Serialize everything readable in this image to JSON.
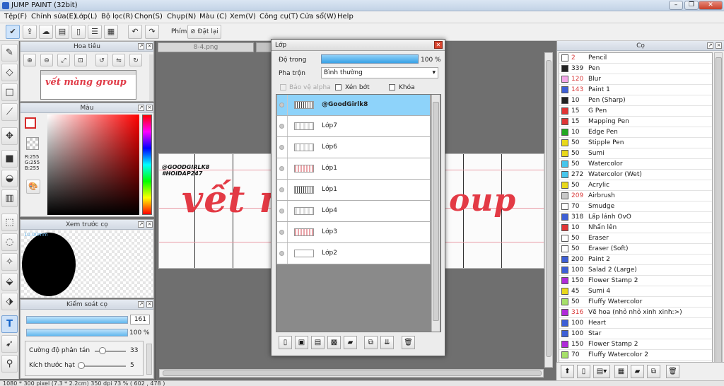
{
  "window": {
    "title": "JUMP PAINT (32bit)"
  },
  "menu": [
    "Tệp(F)",
    "Chỉnh sửa(E)",
    "Lớp(L)",
    "Bộ lọc(R)",
    "Chọn(S)",
    "Chụp(N)",
    "Màu (C)",
    "Xem(V)",
    "Công cụ(T)",
    "Cửa sổ(W)",
    "Help"
  ],
  "toolbar": {
    "phim_label": "Phím",
    "reset_label": "Đặt lại"
  },
  "navigator": {
    "title": "Hoa tiêu",
    "thumb_text": "vết màng group"
  },
  "color": {
    "title": "Màu",
    "r": "R:255",
    "g": "G:255",
    "b": "B:255"
  },
  "preview": {
    "title": "Xem trước cọ",
    "size": "10.00mm"
  },
  "brush_control": {
    "title": "Kiểm soát cọ",
    "size_value": "161",
    "opacity_value": "100 %",
    "scatter_label": "Cường độ phân tán",
    "scatter_value": "33",
    "grain_label": "Kích thước hạt",
    "grain_value": "5"
  },
  "document": {
    "tab": "8-4.png",
    "tags": "@GOODGIRLK8\n#HOIDAP247",
    "banner_left": "vết m",
    "banner_right": "oup"
  },
  "layers": {
    "title": "Lớp",
    "opacity_label": "Độ trong",
    "opacity_value": "100 %",
    "blend_label": "Pha trộn",
    "blend_value": "Bình thường",
    "protect_alpha": "Bảo vệ alpha",
    "clip": "Xén bớt",
    "lock": "Khóa",
    "items": [
      "@GoodGirlk8",
      "Lớp7",
      "Lớp6",
      "Lớp1",
      "Lớp1",
      "Lớp4",
      "Lớp3",
      "Lớp2"
    ]
  },
  "brushes": {
    "title": "Cọ",
    "items": [
      {
        "size": "2",
        "name": "Pencil",
        "color": "#ffffff",
        "red": true
      },
      {
        "size": "339",
        "name": "Pen",
        "color": "#222222",
        "red": false
      },
      {
        "size": "120",
        "name": "Blur",
        "color": "#f3a6e8",
        "red": true
      },
      {
        "size": "143",
        "name": "Paint 1",
        "color": "#3d5fd6",
        "red": true
      },
      {
        "size": "10",
        "name": "Pen (Sharp)",
        "color": "#222222",
        "red": false
      },
      {
        "size": "15",
        "name": "G Pen",
        "color": "#e03535",
        "red": false
      },
      {
        "size": "15",
        "name": "Mapping Pen",
        "color": "#e03535",
        "red": false
      },
      {
        "size": "10",
        "name": "Edge Pen",
        "color": "#22a822",
        "red": false
      },
      {
        "size": "50",
        "name": "Stipple Pen",
        "color": "#e8d81a",
        "red": false
      },
      {
        "size": "50",
        "name": "Sumi",
        "color": "#e8d81a",
        "red": false
      },
      {
        "size": "50",
        "name": "Watercolor",
        "color": "#47c6ec",
        "red": false
      },
      {
        "size": "272",
        "name": "Watercolor (Wet)",
        "color": "#47c6ec",
        "red": false
      },
      {
        "size": "50",
        "name": "Acrylic",
        "color": "#e8d81a",
        "red": false
      },
      {
        "size": "209",
        "name": "Airbrush",
        "color": "#c8c8c8",
        "red": true
      },
      {
        "size": "70",
        "name": "Smudge",
        "color": "#ffffff",
        "red": false
      },
      {
        "size": "318",
        "name": "Lấp lánh OvO",
        "color": "#3d5fd6",
        "red": false
      },
      {
        "size": "10",
        "name": "Nhấn lên",
        "color": "#e03535",
        "red": false
      },
      {
        "size": "50",
        "name": "Eraser",
        "color": "#ffffff",
        "red": false
      },
      {
        "size": "50",
        "name": "Eraser (Soft)",
        "color": "#ffffff",
        "red": false
      },
      {
        "size": "200",
        "name": "Paint 2",
        "color": "#3d5fd6",
        "red": false
      },
      {
        "size": "100",
        "name": "Salad 2 (Large)",
        "color": "#3d5fd6",
        "red": false
      },
      {
        "size": "150",
        "name": "Flower Stamp 2",
        "color": "#b02ad9",
        "red": false
      },
      {
        "size": "45",
        "name": "Sumi 4",
        "color": "#e8d81a",
        "red": false
      },
      {
        "size": "50",
        "name": "Fluffy Watercolor",
        "color": "#a6e06a",
        "red": false
      },
      {
        "size": "316",
        "name": "Vẽ hoa (nhỏ nhỏ xinh xinh:>)",
        "color": "#b02ad9",
        "red": true
      },
      {
        "size": "100",
        "name": "Heart",
        "color": "#3d5fd6",
        "red": false
      },
      {
        "size": "100",
        "name": "Star",
        "color": "#3d5fd6",
        "red": false
      },
      {
        "size": "150",
        "name": "Flower Stamp 2",
        "color": "#b02ad9",
        "red": false
      },
      {
        "size": "70",
        "name": "Fluffy Watercolor 2",
        "color": "#a6e06a",
        "red": false
      }
    ]
  },
  "status": "1080 * 300 pixel   (7.3 * 2.2cm)   350 dpi   73 %   ( 602 , 478 )"
}
